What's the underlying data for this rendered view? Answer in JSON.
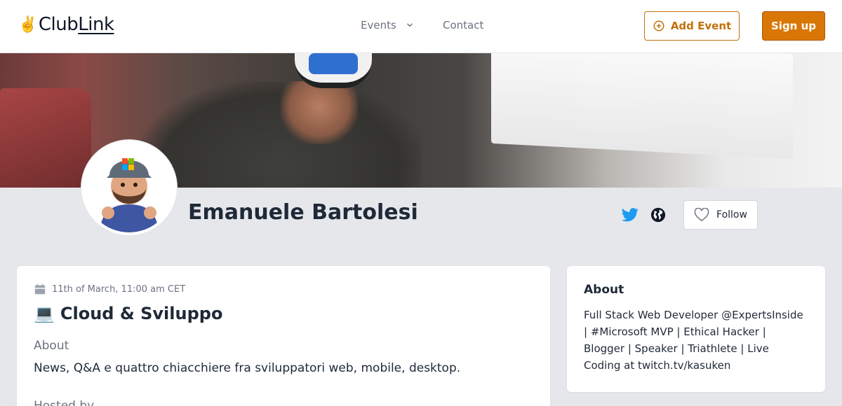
{
  "header": {
    "logo_prefix": "Club",
    "logo_suffix": "Link",
    "nav_events": "Events",
    "nav_contact": "Contact",
    "add_event_label": "Add Event",
    "signup_label": "Sign up"
  },
  "profile": {
    "name": "Emanuele Bartolesi",
    "follow_label": "Follow"
  },
  "event": {
    "date": "11th of March, 11:00 am CET",
    "emoji": "💻",
    "title": "Cloud & Sviluppo",
    "about_label": "About",
    "description": "News, Q&A e quattro chiacchiere fra sviluppatori web, mobile, desktop.",
    "hosted_by_label": "Hosted by"
  },
  "about": {
    "title": "About",
    "text": "Full Stack Web Developer @ExpertsInside | #Microsoft MVP | Ethical Hacker | Blogger | Speaker | Triathlete | Live Coding at twitch.tv/kasuken"
  },
  "colors": {
    "accent": "#d97706",
    "accent_dark": "#c2710c",
    "twitter": "#1d9bf0",
    "page_bg": "#e5e7eb"
  },
  "icons": {
    "logo": "victory-hand-icon",
    "events_dropdown": "chevron-down-icon",
    "add_event": "plus-circle-icon",
    "twitter": "twitter-icon",
    "website": "globe-icon",
    "follow": "heart-icon",
    "date": "calendar-icon"
  }
}
